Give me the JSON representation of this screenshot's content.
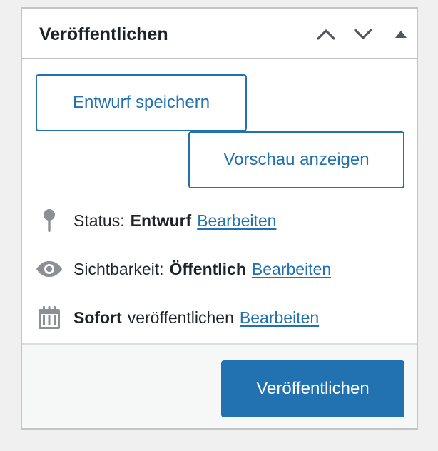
{
  "panel": {
    "title": "Veröffentlichen",
    "header_buttons": {
      "move_up": "chevron-up-icon",
      "move_down": "chevron-down-icon",
      "toggle": "triangle-up-icon"
    }
  },
  "actions": {
    "save_draft_label": "Entwurf speichern",
    "preview_label": "Vorschau anzeigen"
  },
  "misc": {
    "status": {
      "icon": "pin-icon",
      "prefix": "Status:",
      "value": "Entwurf",
      "edit_label": "Bearbeiten"
    },
    "visibility": {
      "icon": "eye-icon",
      "prefix": "Sichtbarkeit:",
      "value": "Öffentlich",
      "edit_label": "Bearbeiten"
    },
    "schedule": {
      "icon": "calendar-icon",
      "value": "Sofort",
      "suffix": "veröffentlichen",
      "edit_label": "Bearbeiten"
    }
  },
  "footer": {
    "publish_label": "Veröffentlichen"
  },
  "colors": {
    "accent": "#2271b1",
    "border": "#c3c4c7",
    "icon_gray": "#8c8f94",
    "text": "#1d2327",
    "footer_bg": "#f6f7f7",
    "page_bg": "#f0f0f1"
  }
}
